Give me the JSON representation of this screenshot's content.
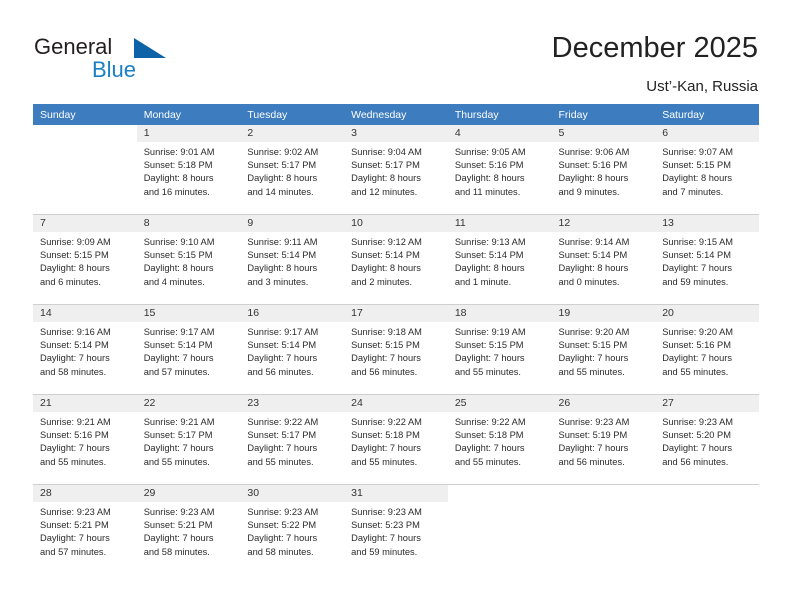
{
  "brand": {
    "name_part1": "General",
    "name_part2": "Blue",
    "accent_color": "#0d63a8",
    "blue_text_color": "#1b7fc4"
  },
  "header": {
    "title": "December 2025",
    "subtitle": "Ust’-Kan, Russia"
  },
  "calendar": {
    "header_bg": "#3c7cbf",
    "daynum_bg": "#efefef",
    "day_names": [
      "Sunday",
      "Monday",
      "Tuesday",
      "Wednesday",
      "Thursday",
      "Friday",
      "Saturday"
    ],
    "weeks": [
      [
        {
          "day": "",
          "sunrise": "",
          "sunset": "",
          "daylight_line1": "",
          "daylight_line2": ""
        },
        {
          "day": "1",
          "sunrise": "Sunrise: 9:01 AM",
          "sunset": "Sunset: 5:18 PM",
          "daylight_line1": "Daylight: 8 hours",
          "daylight_line2": "and 16 minutes."
        },
        {
          "day": "2",
          "sunrise": "Sunrise: 9:02 AM",
          "sunset": "Sunset: 5:17 PM",
          "daylight_line1": "Daylight: 8 hours",
          "daylight_line2": "and 14 minutes."
        },
        {
          "day": "3",
          "sunrise": "Sunrise: 9:04 AM",
          "sunset": "Sunset: 5:17 PM",
          "daylight_line1": "Daylight: 8 hours",
          "daylight_line2": "and 12 minutes."
        },
        {
          "day": "4",
          "sunrise": "Sunrise: 9:05 AM",
          "sunset": "Sunset: 5:16 PM",
          "daylight_line1": "Daylight: 8 hours",
          "daylight_line2": "and 11 minutes."
        },
        {
          "day": "5",
          "sunrise": "Sunrise: 9:06 AM",
          "sunset": "Sunset: 5:16 PM",
          "daylight_line1": "Daylight: 8 hours",
          "daylight_line2": "and 9 minutes."
        },
        {
          "day": "6",
          "sunrise": "Sunrise: 9:07 AM",
          "sunset": "Sunset: 5:15 PM",
          "daylight_line1": "Daylight: 8 hours",
          "daylight_line2": "and 7 minutes."
        }
      ],
      [
        {
          "day": "7",
          "sunrise": "Sunrise: 9:09 AM",
          "sunset": "Sunset: 5:15 PM",
          "daylight_line1": "Daylight: 8 hours",
          "daylight_line2": "and 6 minutes."
        },
        {
          "day": "8",
          "sunrise": "Sunrise: 9:10 AM",
          "sunset": "Sunset: 5:15 PM",
          "daylight_line1": "Daylight: 8 hours",
          "daylight_line2": "and 4 minutes."
        },
        {
          "day": "9",
          "sunrise": "Sunrise: 9:11 AM",
          "sunset": "Sunset: 5:14 PM",
          "daylight_line1": "Daylight: 8 hours",
          "daylight_line2": "and 3 minutes."
        },
        {
          "day": "10",
          "sunrise": "Sunrise: 9:12 AM",
          "sunset": "Sunset: 5:14 PM",
          "daylight_line1": "Daylight: 8 hours",
          "daylight_line2": "and 2 minutes."
        },
        {
          "day": "11",
          "sunrise": "Sunrise: 9:13 AM",
          "sunset": "Sunset: 5:14 PM",
          "daylight_line1": "Daylight: 8 hours",
          "daylight_line2": "and 1 minute."
        },
        {
          "day": "12",
          "sunrise": "Sunrise: 9:14 AM",
          "sunset": "Sunset: 5:14 PM",
          "daylight_line1": "Daylight: 8 hours",
          "daylight_line2": "and 0 minutes."
        },
        {
          "day": "13",
          "sunrise": "Sunrise: 9:15 AM",
          "sunset": "Sunset: 5:14 PM",
          "daylight_line1": "Daylight: 7 hours",
          "daylight_line2": "and 59 minutes."
        }
      ],
      [
        {
          "day": "14",
          "sunrise": "Sunrise: 9:16 AM",
          "sunset": "Sunset: 5:14 PM",
          "daylight_line1": "Daylight: 7 hours",
          "daylight_line2": "and 58 minutes."
        },
        {
          "day": "15",
          "sunrise": "Sunrise: 9:17 AM",
          "sunset": "Sunset: 5:14 PM",
          "daylight_line1": "Daylight: 7 hours",
          "daylight_line2": "and 57 minutes."
        },
        {
          "day": "16",
          "sunrise": "Sunrise: 9:17 AM",
          "sunset": "Sunset: 5:14 PM",
          "daylight_line1": "Daylight: 7 hours",
          "daylight_line2": "and 56 minutes."
        },
        {
          "day": "17",
          "sunrise": "Sunrise: 9:18 AM",
          "sunset": "Sunset: 5:15 PM",
          "daylight_line1": "Daylight: 7 hours",
          "daylight_line2": "and 56 minutes."
        },
        {
          "day": "18",
          "sunrise": "Sunrise: 9:19 AM",
          "sunset": "Sunset: 5:15 PM",
          "daylight_line1": "Daylight: 7 hours",
          "daylight_line2": "and 55 minutes."
        },
        {
          "day": "19",
          "sunrise": "Sunrise: 9:20 AM",
          "sunset": "Sunset: 5:15 PM",
          "daylight_line1": "Daylight: 7 hours",
          "daylight_line2": "and 55 minutes."
        },
        {
          "day": "20",
          "sunrise": "Sunrise: 9:20 AM",
          "sunset": "Sunset: 5:16 PM",
          "daylight_line1": "Daylight: 7 hours",
          "daylight_line2": "and 55 minutes."
        }
      ],
      [
        {
          "day": "21",
          "sunrise": "Sunrise: 9:21 AM",
          "sunset": "Sunset: 5:16 PM",
          "daylight_line1": "Daylight: 7 hours",
          "daylight_line2": "and 55 minutes."
        },
        {
          "day": "22",
          "sunrise": "Sunrise: 9:21 AM",
          "sunset": "Sunset: 5:17 PM",
          "daylight_line1": "Daylight: 7 hours",
          "daylight_line2": "and 55 minutes."
        },
        {
          "day": "23",
          "sunrise": "Sunrise: 9:22 AM",
          "sunset": "Sunset: 5:17 PM",
          "daylight_line1": "Daylight: 7 hours",
          "daylight_line2": "and 55 minutes."
        },
        {
          "day": "24",
          "sunrise": "Sunrise: 9:22 AM",
          "sunset": "Sunset: 5:18 PM",
          "daylight_line1": "Daylight: 7 hours",
          "daylight_line2": "and 55 minutes."
        },
        {
          "day": "25",
          "sunrise": "Sunrise: 9:22 AM",
          "sunset": "Sunset: 5:18 PM",
          "daylight_line1": "Daylight: 7 hours",
          "daylight_line2": "and 55 minutes."
        },
        {
          "day": "26",
          "sunrise": "Sunrise: 9:23 AM",
          "sunset": "Sunset: 5:19 PM",
          "daylight_line1": "Daylight: 7 hours",
          "daylight_line2": "and 56 minutes."
        },
        {
          "day": "27",
          "sunrise": "Sunrise: 9:23 AM",
          "sunset": "Sunset: 5:20 PM",
          "daylight_line1": "Daylight: 7 hours",
          "daylight_line2": "and 56 minutes."
        }
      ],
      [
        {
          "day": "28",
          "sunrise": "Sunrise: 9:23 AM",
          "sunset": "Sunset: 5:21 PM",
          "daylight_line1": "Daylight: 7 hours",
          "daylight_line2": "and 57 minutes."
        },
        {
          "day": "29",
          "sunrise": "Sunrise: 9:23 AM",
          "sunset": "Sunset: 5:21 PM",
          "daylight_line1": "Daylight: 7 hours",
          "daylight_line2": "and 58 minutes."
        },
        {
          "day": "30",
          "sunrise": "Sunrise: 9:23 AM",
          "sunset": "Sunset: 5:22 PM",
          "daylight_line1": "Daylight: 7 hours",
          "daylight_line2": "and 58 minutes."
        },
        {
          "day": "31",
          "sunrise": "Sunrise: 9:23 AM",
          "sunset": "Sunset: 5:23 PM",
          "daylight_line1": "Daylight: 7 hours",
          "daylight_line2": "and 59 minutes."
        },
        {
          "day": "",
          "sunrise": "",
          "sunset": "",
          "daylight_line1": "",
          "daylight_line2": ""
        },
        {
          "day": "",
          "sunrise": "",
          "sunset": "",
          "daylight_line1": "",
          "daylight_line2": ""
        },
        {
          "day": "",
          "sunrise": "",
          "sunset": "",
          "daylight_line1": "",
          "daylight_line2": ""
        }
      ]
    ]
  }
}
